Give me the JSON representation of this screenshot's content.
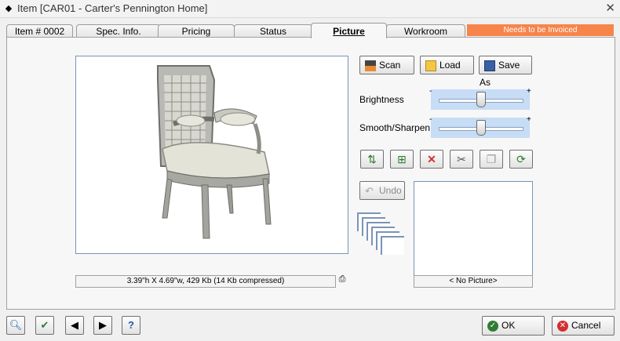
{
  "window": {
    "title": "Item [CAR01 - Carter's Pennington Home]",
    "close_icon": "close-icon"
  },
  "tabs": [
    {
      "label": "Item # 0002"
    },
    {
      "label": "Spec. Info."
    },
    {
      "label": "Pricing"
    },
    {
      "label": "Status"
    },
    {
      "label": "Picture"
    },
    {
      "label": "Workroom"
    }
  ],
  "active_tab": "Picture",
  "banner": {
    "text": "Needs to be Invoiced",
    "color": "#f7844a"
  },
  "image_panel": {
    "status": "3.39\"h X 4.69\"w, 429 Kb (14 Kb compressed)"
  },
  "actions": {
    "scan": "Scan",
    "load": "Load",
    "save_as": "Save As"
  },
  "adjust": {
    "brightness_label": "Brightness",
    "brightness_value": 0.5,
    "sharpen_label": "Smooth/Sharpen",
    "sharpen_value": 0.5,
    "minus": "-",
    "plus": "+"
  },
  "undo_label": "Undo",
  "thumbnail": {
    "caption": "< No Picture>"
  },
  "footer": {
    "ok_label": "OK",
    "cancel_label": "Cancel"
  }
}
